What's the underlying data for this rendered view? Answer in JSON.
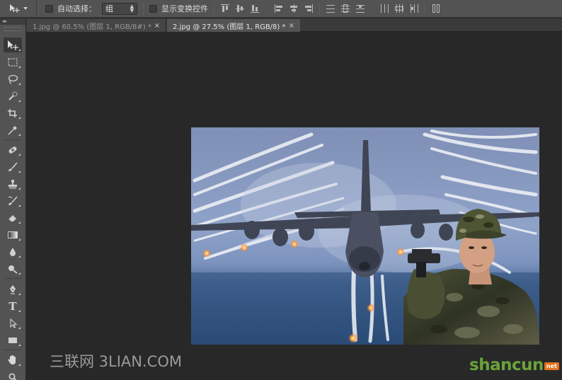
{
  "options_bar": {
    "auto_select_label": "自动选择：",
    "auto_select_value": "组",
    "show_transform_label": "显示变换控件"
  },
  "tabs": [
    {
      "label": "1.jpg @ 60.5% (图层 1, RGB/8#) *",
      "close": "×"
    },
    {
      "label": "2.jpg @ 27.5% (图层 1, RGB/8) *",
      "close": "×"
    }
  ],
  "tools": [
    "move-tool",
    "marquee-tool",
    "lasso-tool",
    "quick-select-tool",
    "crop-tool",
    "eyedropper-tool",
    "healing-brush-tool",
    "brush-tool",
    "clone-stamp-tool",
    "history-brush-tool",
    "eraser-tool",
    "gradient-tool",
    "blur-tool",
    "dodge-tool",
    "pen-tool",
    "type-tool",
    "path-select-tool",
    "rectangle-tool",
    "hand-tool",
    "zoom-tool"
  ],
  "type_tool_glyph": "T",
  "toolbar_grip": "▸▸",
  "watermarks": {
    "left": "三联网 3LIAN.COM",
    "right_brand": "shancun",
    "right_suffix": "net"
  },
  "colors": {
    "ui_dark": "#282828",
    "panel": "#535353",
    "watermark_green": "#6aa33a",
    "watermark_orange": "#e5721e"
  }
}
